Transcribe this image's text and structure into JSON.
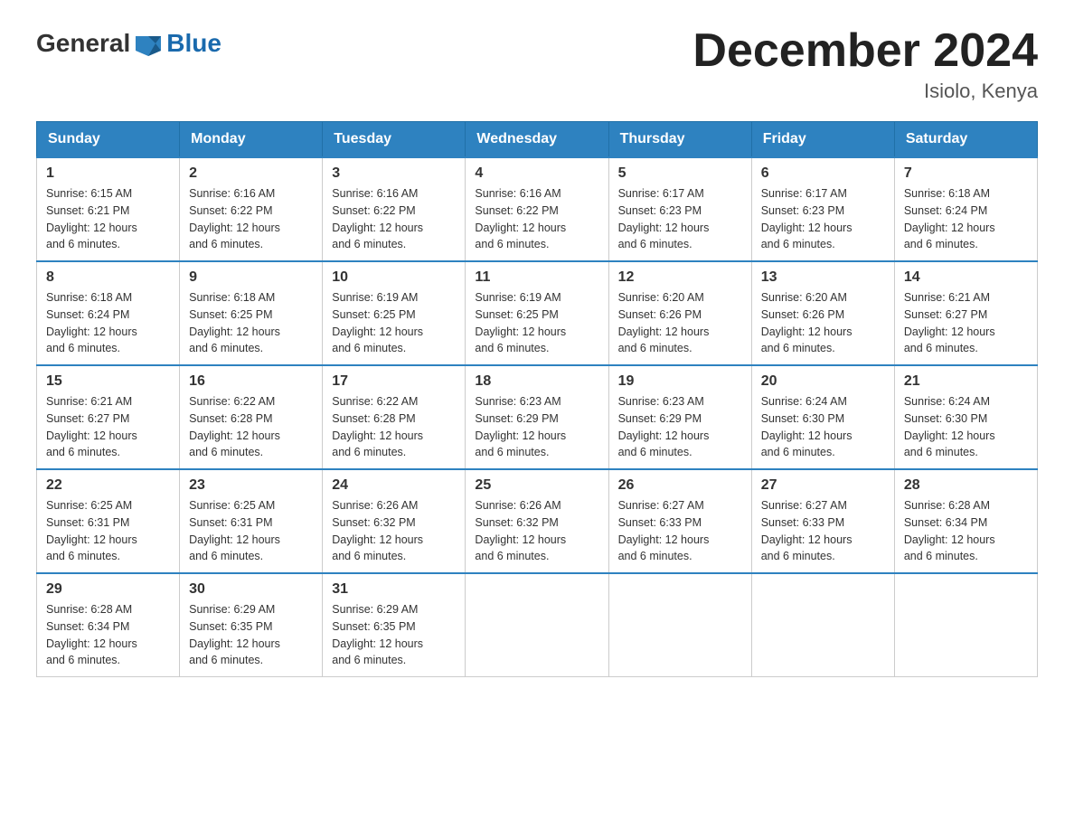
{
  "header": {
    "logo_text_general": "General",
    "logo_text_blue": "Blue",
    "month_title": "December 2024",
    "location": "Isiolo, Kenya"
  },
  "days_of_week": [
    "Sunday",
    "Monday",
    "Tuesday",
    "Wednesday",
    "Thursday",
    "Friday",
    "Saturday"
  ],
  "weeks": [
    [
      {
        "day": "1",
        "sunrise": "6:15 AM",
        "sunset": "6:21 PM",
        "daylight": "12 hours and 6 minutes."
      },
      {
        "day": "2",
        "sunrise": "6:16 AM",
        "sunset": "6:22 PM",
        "daylight": "12 hours and 6 minutes."
      },
      {
        "day": "3",
        "sunrise": "6:16 AM",
        "sunset": "6:22 PM",
        "daylight": "12 hours and 6 minutes."
      },
      {
        "day": "4",
        "sunrise": "6:16 AM",
        "sunset": "6:22 PM",
        "daylight": "12 hours and 6 minutes."
      },
      {
        "day": "5",
        "sunrise": "6:17 AM",
        "sunset": "6:23 PM",
        "daylight": "12 hours and 6 minutes."
      },
      {
        "day": "6",
        "sunrise": "6:17 AM",
        "sunset": "6:23 PM",
        "daylight": "12 hours and 6 minutes."
      },
      {
        "day": "7",
        "sunrise": "6:18 AM",
        "sunset": "6:24 PM",
        "daylight": "12 hours and 6 minutes."
      }
    ],
    [
      {
        "day": "8",
        "sunrise": "6:18 AM",
        "sunset": "6:24 PM",
        "daylight": "12 hours and 6 minutes."
      },
      {
        "day": "9",
        "sunrise": "6:18 AM",
        "sunset": "6:25 PM",
        "daylight": "12 hours and 6 minutes."
      },
      {
        "day": "10",
        "sunrise": "6:19 AM",
        "sunset": "6:25 PM",
        "daylight": "12 hours and 6 minutes."
      },
      {
        "day": "11",
        "sunrise": "6:19 AM",
        "sunset": "6:25 PM",
        "daylight": "12 hours and 6 minutes."
      },
      {
        "day": "12",
        "sunrise": "6:20 AM",
        "sunset": "6:26 PM",
        "daylight": "12 hours and 6 minutes."
      },
      {
        "day": "13",
        "sunrise": "6:20 AM",
        "sunset": "6:26 PM",
        "daylight": "12 hours and 6 minutes."
      },
      {
        "day": "14",
        "sunrise": "6:21 AM",
        "sunset": "6:27 PM",
        "daylight": "12 hours and 6 minutes."
      }
    ],
    [
      {
        "day": "15",
        "sunrise": "6:21 AM",
        "sunset": "6:27 PM",
        "daylight": "12 hours and 6 minutes."
      },
      {
        "day": "16",
        "sunrise": "6:22 AM",
        "sunset": "6:28 PM",
        "daylight": "12 hours and 6 minutes."
      },
      {
        "day": "17",
        "sunrise": "6:22 AM",
        "sunset": "6:28 PM",
        "daylight": "12 hours and 6 minutes."
      },
      {
        "day": "18",
        "sunrise": "6:23 AM",
        "sunset": "6:29 PM",
        "daylight": "12 hours and 6 minutes."
      },
      {
        "day": "19",
        "sunrise": "6:23 AM",
        "sunset": "6:29 PM",
        "daylight": "12 hours and 6 minutes."
      },
      {
        "day": "20",
        "sunrise": "6:24 AM",
        "sunset": "6:30 PM",
        "daylight": "12 hours and 6 minutes."
      },
      {
        "day": "21",
        "sunrise": "6:24 AM",
        "sunset": "6:30 PM",
        "daylight": "12 hours and 6 minutes."
      }
    ],
    [
      {
        "day": "22",
        "sunrise": "6:25 AM",
        "sunset": "6:31 PM",
        "daylight": "12 hours and 6 minutes."
      },
      {
        "day": "23",
        "sunrise": "6:25 AM",
        "sunset": "6:31 PM",
        "daylight": "12 hours and 6 minutes."
      },
      {
        "day": "24",
        "sunrise": "6:26 AM",
        "sunset": "6:32 PM",
        "daylight": "12 hours and 6 minutes."
      },
      {
        "day": "25",
        "sunrise": "6:26 AM",
        "sunset": "6:32 PM",
        "daylight": "12 hours and 6 minutes."
      },
      {
        "day": "26",
        "sunrise": "6:27 AM",
        "sunset": "6:33 PM",
        "daylight": "12 hours and 6 minutes."
      },
      {
        "day": "27",
        "sunrise": "6:27 AM",
        "sunset": "6:33 PM",
        "daylight": "12 hours and 6 minutes."
      },
      {
        "day": "28",
        "sunrise": "6:28 AM",
        "sunset": "6:34 PM",
        "daylight": "12 hours and 6 minutes."
      }
    ],
    [
      {
        "day": "29",
        "sunrise": "6:28 AM",
        "sunset": "6:34 PM",
        "daylight": "12 hours and 6 minutes."
      },
      {
        "day": "30",
        "sunrise": "6:29 AM",
        "sunset": "6:35 PM",
        "daylight": "12 hours and 6 minutes."
      },
      {
        "day": "31",
        "sunrise": "6:29 AM",
        "sunset": "6:35 PM",
        "daylight": "12 hours and 6 minutes."
      },
      null,
      null,
      null,
      null
    ]
  ],
  "labels": {
    "sunrise": "Sunrise:",
    "sunset": "Sunset:",
    "daylight": "Daylight:"
  },
  "colors": {
    "header_bg": "#2e82c0",
    "accent": "#1a6aad"
  }
}
